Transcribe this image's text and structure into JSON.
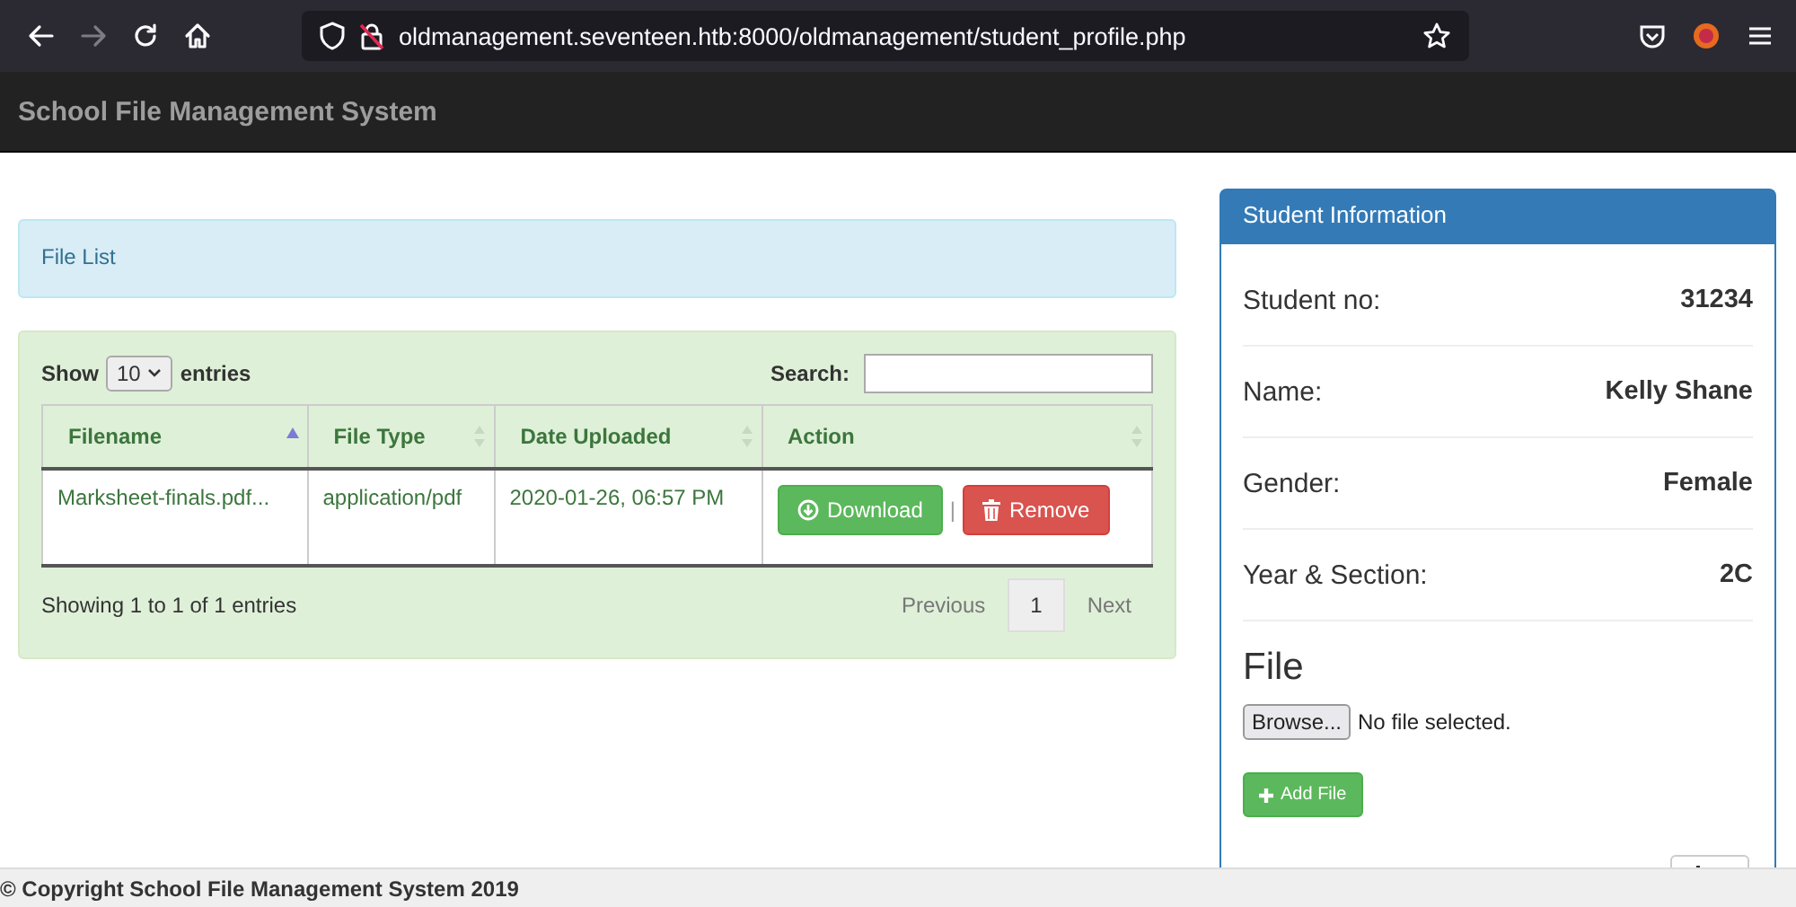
{
  "browser": {
    "url": "oldmanagement.seventeen.htb:8000/oldmanagement/student_profile.php"
  },
  "navbar": {
    "brand": "School File Management System"
  },
  "alert": {
    "text": "File List"
  },
  "table_controls": {
    "show_label": "Show",
    "page_size": "10",
    "entries_label": "entries",
    "search_label": "Search:"
  },
  "table": {
    "columns": [
      {
        "label": "Filename",
        "sorted": true
      },
      {
        "label": "File Type",
        "sorted": false
      },
      {
        "label": "Date Uploaded",
        "sorted": false
      },
      {
        "label": "Action",
        "sorted": false
      }
    ],
    "rows": [
      {
        "cells": [
          "Marksheet-finals.pdf...",
          "application/pdf",
          "2020-01-26, 06:57 PM"
        ],
        "separator": "|",
        "actions": [
          {
            "label": "Download",
            "kind": "download"
          },
          {
            "label": "Remove",
            "kind": "remove"
          }
        ]
      }
    ]
  },
  "pagination": {
    "info": "Showing 1 to 1 of 1 entries",
    "previous": "Previous",
    "pages": [
      {
        "label": "1",
        "selected": true
      }
    ],
    "next": "Next"
  },
  "student_panel": {
    "title": "Student Information",
    "fields": [
      {
        "label": "Student no:",
        "value": "31234"
      },
      {
        "label": "Name:",
        "value": "Kelly Shane"
      },
      {
        "label": "Gender:",
        "value": "Female"
      },
      {
        "label": "Year & Section:",
        "value": "2C"
      }
    ],
    "file_heading": "File",
    "browse_button": "Browse...",
    "file_status": "No file selected.",
    "add_button": "Add File"
  },
  "footer": {
    "text": "© Copyright School File Management System 2019"
  }
}
